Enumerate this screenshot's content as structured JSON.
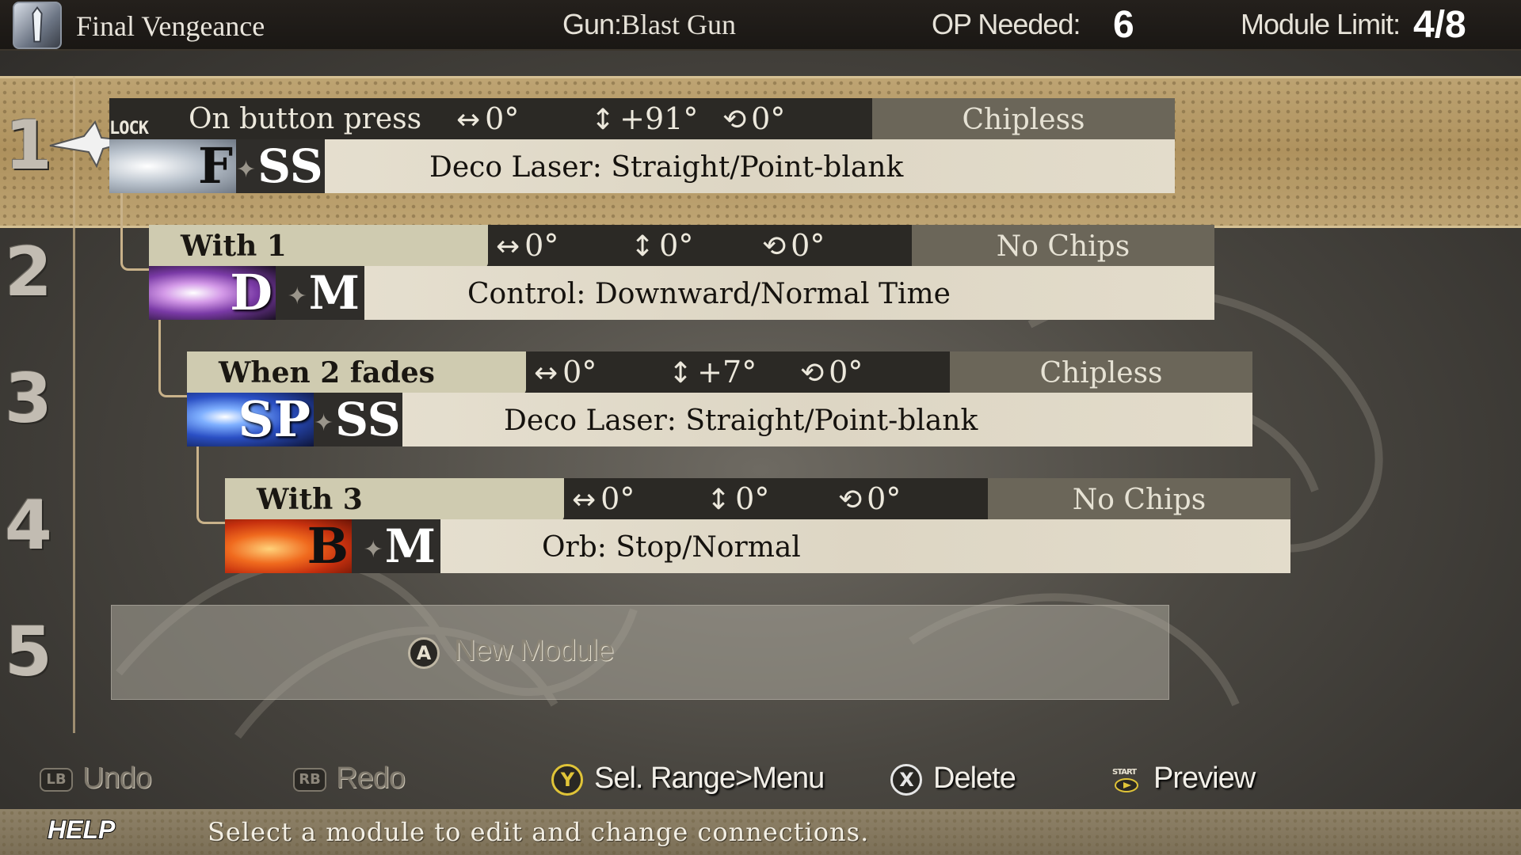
{
  "header": {
    "title": "Final Vengeance",
    "gun_label": "Gun:",
    "gun_value": "Blast Gun",
    "op_label": "OP Needed:",
    "op_value": "6",
    "module_label": "Module  Limit:",
    "module_value": "4/8"
  },
  "slots": [
    "1",
    "2",
    "3",
    "4",
    "5"
  ],
  "modules": [
    {
      "lock_tag": "LOCK",
      "trigger": "On button press",
      "h_angle": "0°",
      "v_angle": "+91°",
      "rot_angle": "0°",
      "chips": "Chipless",
      "bullet_letter": "F",
      "bullet_modifier": "SS",
      "bullet_name": "Deco Laser: Straight/Point-blank",
      "art_color": "#c6ccd4"
    },
    {
      "trigger": "With  1",
      "h_angle": "0°",
      "v_angle": "0°",
      "rot_angle": "0°",
      "chips": "No Chips",
      "bullet_letter": "D",
      "bullet_modifier": "M",
      "bullet_name": "Control: Downward/Normal Time",
      "art_color": "#b86ad0"
    },
    {
      "trigger": "When  2 fades",
      "h_angle": "0°",
      "v_angle": "+7°",
      "rot_angle": "0°",
      "chips": "Chipless",
      "bullet_letter": "SP",
      "bullet_modifier": "SS",
      "bullet_name": "Deco Laser: Straight/Point-blank",
      "art_color": "#3a66d8"
    },
    {
      "trigger": "With  3",
      "h_angle": "0°",
      "v_angle": "0°",
      "rot_angle": "0°",
      "chips": "No Chips",
      "bullet_letter": "B",
      "bullet_modifier": "M",
      "bullet_name": "Orb: Stop/Normal",
      "art_color": "#e0501e"
    }
  ],
  "new_module": {
    "button": "A",
    "label": "New Module"
  },
  "controls": {
    "undo": {
      "button": "LB",
      "label": "Undo"
    },
    "redo": {
      "button": "RB",
      "label": "Redo"
    },
    "menu": {
      "button": "Y",
      "label": "Sel. Range>Menu"
    },
    "delete": {
      "button": "X",
      "label": "Delete"
    },
    "preview": {
      "button": "START",
      "label": "Preview"
    }
  },
  "help": {
    "tag": "HELP",
    "text": "Select a module to edit and change connections."
  },
  "colors": {
    "accent_band": "#c9ad78",
    "trigger_bg": "#cfcbb0",
    "chips_bg": "#6b6659"
  }
}
